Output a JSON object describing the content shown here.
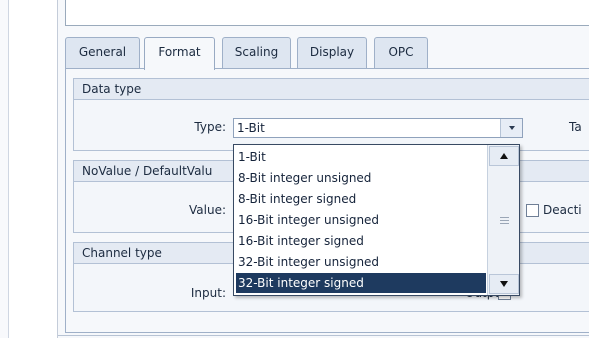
{
  "tabs": [
    {
      "label": "General",
      "active": false
    },
    {
      "label": "Format",
      "active": true
    },
    {
      "label": "Scaling",
      "active": false
    },
    {
      "label": "Display",
      "active": false
    },
    {
      "label": "OPC",
      "active": false
    }
  ],
  "groups": {
    "data_type": {
      "title": "Data type",
      "type_label": "Type:",
      "type_value": "1-Bit",
      "right_label_fragment": "Ta"
    },
    "novalue": {
      "title": "NoValue / DefaultValu",
      "value_label": "Value:",
      "checkbox_label_fragment": "Deacti"
    },
    "channel": {
      "title": "Channel type",
      "input_label": "Input:",
      "output_label_fragment": "Output"
    }
  },
  "dropdown": {
    "options": [
      "1-Bit",
      "8-Bit integer unsigned",
      "8-Bit integer signed",
      "16-Bit integer unsigned",
      "16-Bit integer signed",
      "32-Bit integer unsigned",
      "32-Bit integer signed"
    ],
    "highlighted_index": 6
  },
  "colors": {
    "selection": "#1e3a5f",
    "tab_border": "#9fb0c8",
    "header_bg": "#e4eaf3"
  }
}
